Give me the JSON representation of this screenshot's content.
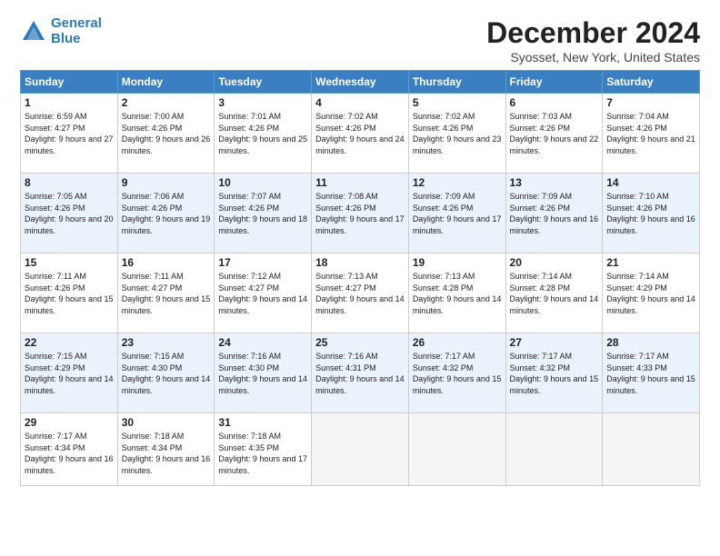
{
  "logo": {
    "line1": "General",
    "line2": "Blue"
  },
  "title": "December 2024",
  "location": "Syosset, New York, United States",
  "days_of_week": [
    "Sunday",
    "Monday",
    "Tuesday",
    "Wednesday",
    "Thursday",
    "Friday",
    "Saturday"
  ],
  "weeks": [
    [
      {
        "day": "1",
        "sunrise": "6:59 AM",
        "sunset": "4:27 PM",
        "daylight": "9 hours and 27 minutes."
      },
      {
        "day": "2",
        "sunrise": "7:00 AM",
        "sunset": "4:26 PM",
        "daylight": "9 hours and 26 minutes."
      },
      {
        "day": "3",
        "sunrise": "7:01 AM",
        "sunset": "4:26 PM",
        "daylight": "9 hours and 25 minutes."
      },
      {
        "day": "4",
        "sunrise": "7:02 AM",
        "sunset": "4:26 PM",
        "daylight": "9 hours and 24 minutes."
      },
      {
        "day": "5",
        "sunrise": "7:02 AM",
        "sunset": "4:26 PM",
        "daylight": "9 hours and 23 minutes."
      },
      {
        "day": "6",
        "sunrise": "7:03 AM",
        "sunset": "4:26 PM",
        "daylight": "9 hours and 22 minutes."
      },
      {
        "day": "7",
        "sunrise": "7:04 AM",
        "sunset": "4:26 PM",
        "daylight": "9 hours and 21 minutes."
      }
    ],
    [
      {
        "day": "8",
        "sunrise": "7:05 AM",
        "sunset": "4:26 PM",
        "daylight": "9 hours and 20 minutes."
      },
      {
        "day": "9",
        "sunrise": "7:06 AM",
        "sunset": "4:26 PM",
        "daylight": "9 hours and 19 minutes."
      },
      {
        "day": "10",
        "sunrise": "7:07 AM",
        "sunset": "4:26 PM",
        "daylight": "9 hours and 18 minutes."
      },
      {
        "day": "11",
        "sunrise": "7:08 AM",
        "sunset": "4:26 PM",
        "daylight": "9 hours and 17 minutes."
      },
      {
        "day": "12",
        "sunrise": "7:09 AM",
        "sunset": "4:26 PM",
        "daylight": "9 hours and 17 minutes."
      },
      {
        "day": "13",
        "sunrise": "7:09 AM",
        "sunset": "4:26 PM",
        "daylight": "9 hours and 16 minutes."
      },
      {
        "day": "14",
        "sunrise": "7:10 AM",
        "sunset": "4:26 PM",
        "daylight": "9 hours and 16 minutes."
      }
    ],
    [
      {
        "day": "15",
        "sunrise": "7:11 AM",
        "sunset": "4:26 PM",
        "daylight": "9 hours and 15 minutes."
      },
      {
        "day": "16",
        "sunrise": "7:11 AM",
        "sunset": "4:27 PM",
        "daylight": "9 hours and 15 minutes."
      },
      {
        "day": "17",
        "sunrise": "7:12 AM",
        "sunset": "4:27 PM",
        "daylight": "9 hours and 14 minutes."
      },
      {
        "day": "18",
        "sunrise": "7:13 AM",
        "sunset": "4:27 PM",
        "daylight": "9 hours and 14 minutes."
      },
      {
        "day": "19",
        "sunrise": "7:13 AM",
        "sunset": "4:28 PM",
        "daylight": "9 hours and 14 minutes."
      },
      {
        "day": "20",
        "sunrise": "7:14 AM",
        "sunset": "4:28 PM",
        "daylight": "9 hours and 14 minutes."
      },
      {
        "day": "21",
        "sunrise": "7:14 AM",
        "sunset": "4:29 PM",
        "daylight": "9 hours and 14 minutes."
      }
    ],
    [
      {
        "day": "22",
        "sunrise": "7:15 AM",
        "sunset": "4:29 PM",
        "daylight": "9 hours and 14 minutes."
      },
      {
        "day": "23",
        "sunrise": "7:15 AM",
        "sunset": "4:30 PM",
        "daylight": "9 hours and 14 minutes."
      },
      {
        "day": "24",
        "sunrise": "7:16 AM",
        "sunset": "4:30 PM",
        "daylight": "9 hours and 14 minutes."
      },
      {
        "day": "25",
        "sunrise": "7:16 AM",
        "sunset": "4:31 PM",
        "daylight": "9 hours and 14 minutes."
      },
      {
        "day": "26",
        "sunrise": "7:17 AM",
        "sunset": "4:32 PM",
        "daylight": "9 hours and 15 minutes."
      },
      {
        "day": "27",
        "sunrise": "7:17 AM",
        "sunset": "4:32 PM",
        "daylight": "9 hours and 15 minutes."
      },
      {
        "day": "28",
        "sunrise": "7:17 AM",
        "sunset": "4:33 PM",
        "daylight": "9 hours and 15 minutes."
      }
    ],
    [
      {
        "day": "29",
        "sunrise": "7:17 AM",
        "sunset": "4:34 PM",
        "daylight": "9 hours and 16 minutes."
      },
      {
        "day": "30",
        "sunrise": "7:18 AM",
        "sunset": "4:34 PM",
        "daylight": "9 hours and 16 minutes."
      },
      {
        "day": "31",
        "sunrise": "7:18 AM",
        "sunset": "4:35 PM",
        "daylight": "9 hours and 17 minutes."
      },
      null,
      null,
      null,
      null
    ]
  ],
  "labels": {
    "sunrise": "Sunrise:",
    "sunset": "Sunset:",
    "daylight": "Daylight:"
  }
}
